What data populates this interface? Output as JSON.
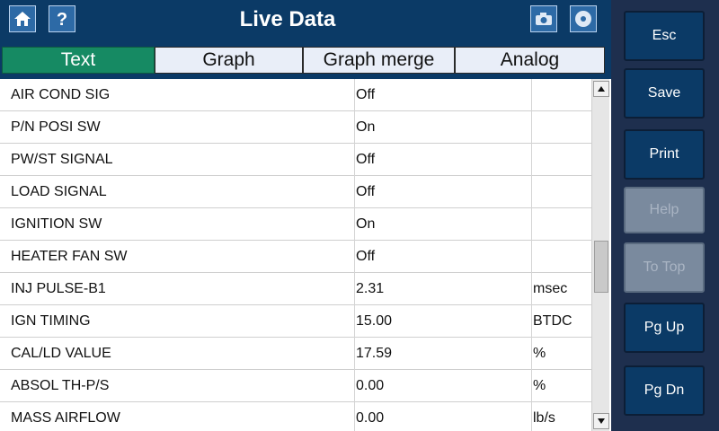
{
  "header": {
    "title": "Live Data",
    "icons": [
      "home-icon",
      "help-icon",
      "camera-icon",
      "disc-icon"
    ]
  },
  "tabs": [
    {
      "label": "Text",
      "active": true
    },
    {
      "label": "Graph",
      "active": false
    },
    {
      "label": "Graph merge",
      "active": false
    },
    {
      "label": "Analog",
      "active": false
    }
  ],
  "rows": [
    {
      "name": "AIR COND SIG",
      "value": "Off",
      "unit": ""
    },
    {
      "name": "P/N POSI SW",
      "value": "On",
      "unit": ""
    },
    {
      "name": "PW/ST SIGNAL",
      "value": "Off",
      "unit": ""
    },
    {
      "name": "LOAD SIGNAL",
      "value": "Off",
      "unit": ""
    },
    {
      "name": "IGNITION SW",
      "value": "On",
      "unit": ""
    },
    {
      "name": "HEATER FAN SW",
      "value": "Off",
      "unit": ""
    },
    {
      "name": "INJ PULSE-B1",
      "value": "2.31",
      "unit": "msec"
    },
    {
      "name": "IGN TIMING",
      "value": "15.00",
      "unit": "BTDC"
    },
    {
      "name": "CAL/LD VALUE",
      "value": "17.59",
      "unit": "%"
    },
    {
      "name": "ABSOL TH-P/S",
      "value": "0.00",
      "unit": "%"
    },
    {
      "name": "MASS AIRFLOW",
      "value": "0.00",
      "unit": "lb/s"
    }
  ],
  "sidebar": {
    "esc": "Esc",
    "save": "Save",
    "print": "Print",
    "help": "Help",
    "to_top": "To Top",
    "pg_up": "Pg Up",
    "pg_dn": "Pg Dn"
  },
  "colors": {
    "header_bg": "#0b3a66",
    "active_tab": "#168a63",
    "sidebar_bg": "#1e2f4e",
    "button_bg": "#0b3a66",
    "disabled_button": "#7a8a9e"
  }
}
